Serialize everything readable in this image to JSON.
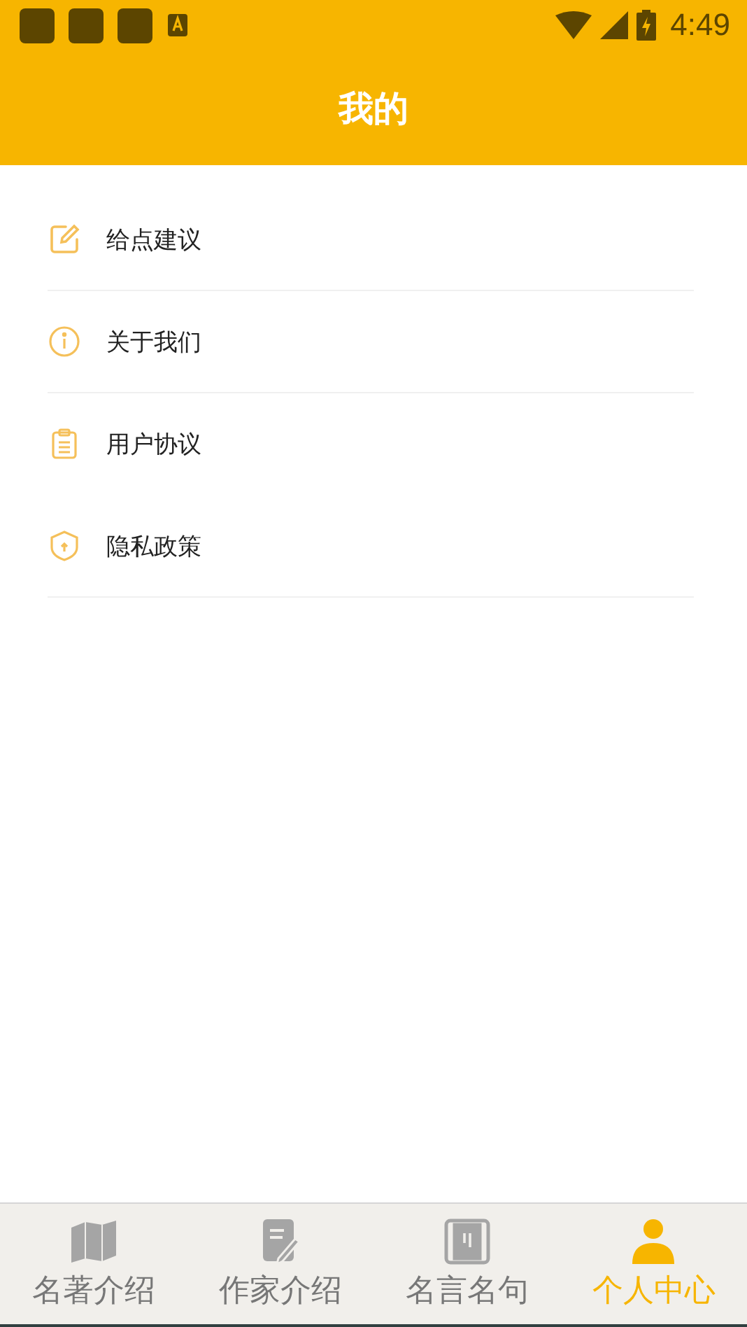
{
  "status_bar": {
    "time": "4:49"
  },
  "header": {
    "title": "我的"
  },
  "menu": [
    {
      "label": "给点建议",
      "divider": true
    },
    {
      "label": "关于我们",
      "divider": true
    },
    {
      "label": "用户协议",
      "divider": false
    },
    {
      "label": "隐私政策",
      "divider": true
    }
  ],
  "tabs": [
    {
      "label": "名著介绍",
      "selected": false
    },
    {
      "label": "作家介绍",
      "selected": false
    },
    {
      "label": "名言名句",
      "selected": false
    },
    {
      "label": "个人中心",
      "selected": true
    }
  ]
}
